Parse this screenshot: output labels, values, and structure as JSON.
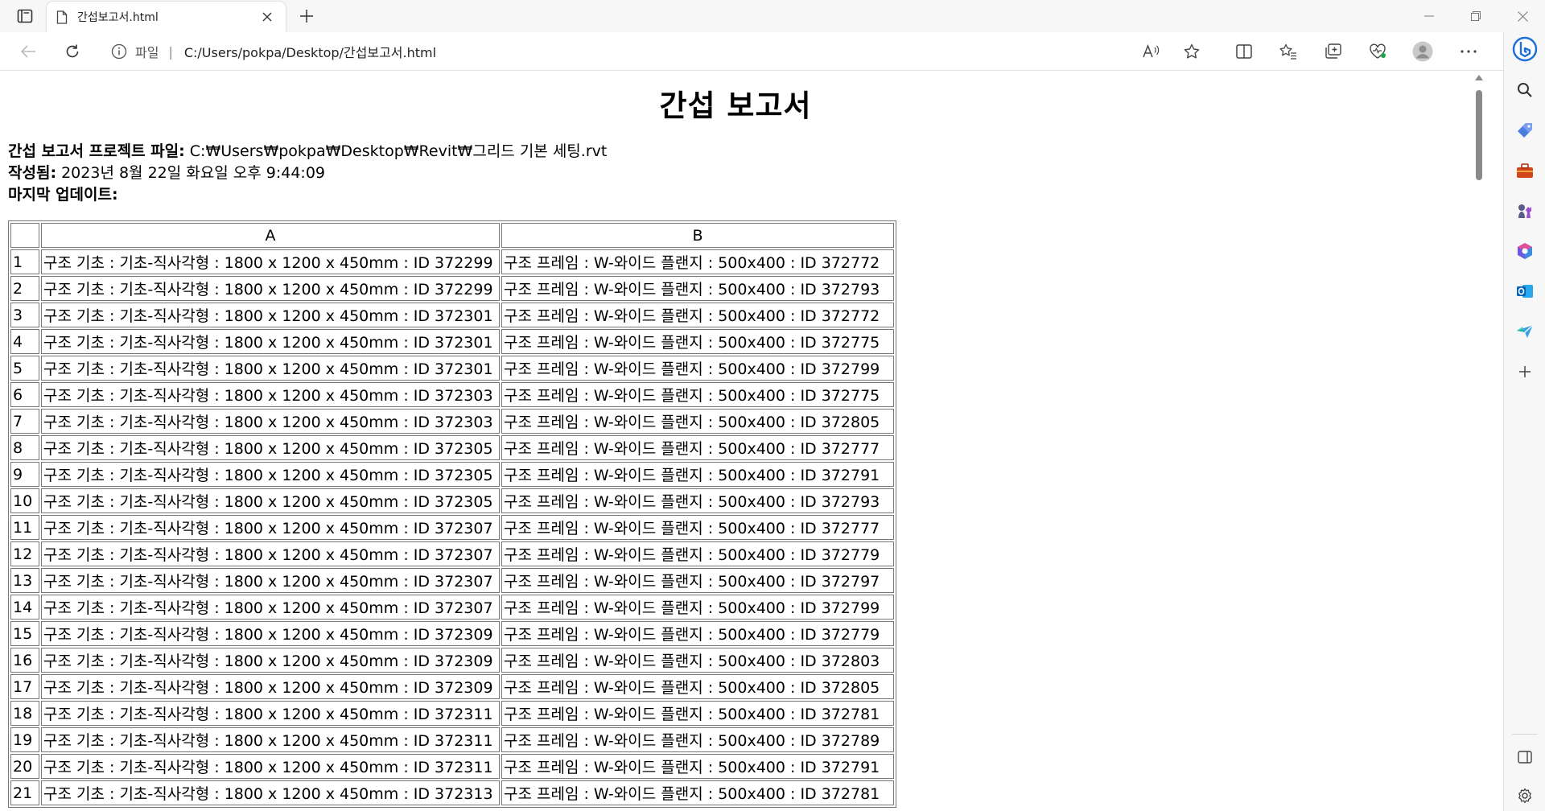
{
  "browser": {
    "tab_title": "간섭보고서.html",
    "address_scheme": "파일",
    "address_path": "C:/Users/pokpa/Desktop/간섭보고서.html"
  },
  "report": {
    "title": "간섭 보고서",
    "project_label": "간섭 보고서 프로젝트 파일:",
    "project_value": "C:₩Users₩pokpa₩Desktop₩Revit₩그리드 기본 세팅.rvt",
    "created_label": "작성됨:",
    "created_value": "2023년 8월 22일 화요일 오후 9:44:09",
    "updated_label": "마지막 업데이트:",
    "table": {
      "headers": [
        "",
        "A",
        "B"
      ],
      "rows": [
        [
          "1",
          "구조 기초 : 기초-직사각형 : 1800 x 1200 x 450mm : ID 372299",
          "구조 프레임 : W-와이드 플랜지 : 500x400 : ID 372772"
        ],
        [
          "2",
          "구조 기초 : 기초-직사각형 : 1800 x 1200 x 450mm : ID 372299",
          "구조 프레임 : W-와이드 플랜지 : 500x400 : ID 372793"
        ],
        [
          "3",
          "구조 기초 : 기초-직사각형 : 1800 x 1200 x 450mm : ID 372301",
          "구조 프레임 : W-와이드 플랜지 : 500x400 : ID 372772"
        ],
        [
          "4",
          "구조 기초 : 기초-직사각형 : 1800 x 1200 x 450mm : ID 372301",
          "구조 프레임 : W-와이드 플랜지 : 500x400 : ID 372775"
        ],
        [
          "5",
          "구조 기초 : 기초-직사각형 : 1800 x 1200 x 450mm : ID 372301",
          "구조 프레임 : W-와이드 플랜지 : 500x400 : ID 372799"
        ],
        [
          "6",
          "구조 기초 : 기초-직사각형 : 1800 x 1200 x 450mm : ID 372303",
          "구조 프레임 : W-와이드 플랜지 : 500x400 : ID 372775"
        ],
        [
          "7",
          "구조 기초 : 기초-직사각형 : 1800 x 1200 x 450mm : ID 372303",
          "구조 프레임 : W-와이드 플랜지 : 500x400 : ID 372805"
        ],
        [
          "8",
          "구조 기초 : 기초-직사각형 : 1800 x 1200 x 450mm : ID 372305",
          "구조 프레임 : W-와이드 플랜지 : 500x400 : ID 372777"
        ],
        [
          "9",
          "구조 기초 : 기초-직사각형 : 1800 x 1200 x 450mm : ID 372305",
          "구조 프레임 : W-와이드 플랜지 : 500x400 : ID 372791"
        ],
        [
          "10",
          "구조 기초 : 기초-직사각형 : 1800 x 1200 x 450mm : ID 372305",
          "구조 프레임 : W-와이드 플랜지 : 500x400 : ID 372793"
        ],
        [
          "11",
          "구조 기초 : 기초-직사각형 : 1800 x 1200 x 450mm : ID 372307",
          "구조 프레임 : W-와이드 플랜지 : 500x400 : ID 372777"
        ],
        [
          "12",
          "구조 기초 : 기초-직사각형 : 1800 x 1200 x 450mm : ID 372307",
          "구조 프레임 : W-와이드 플랜지 : 500x400 : ID 372779"
        ],
        [
          "13",
          "구조 기초 : 기초-직사각형 : 1800 x 1200 x 450mm : ID 372307",
          "구조 프레임 : W-와이드 플랜지 : 500x400 : ID 372797"
        ],
        [
          "14",
          "구조 기초 : 기초-직사각형 : 1800 x 1200 x 450mm : ID 372307",
          "구조 프레임 : W-와이드 플랜지 : 500x400 : ID 372799"
        ],
        [
          "15",
          "구조 기초 : 기초-직사각형 : 1800 x 1200 x 450mm : ID 372309",
          "구조 프레임 : W-와이드 플랜지 : 500x400 : ID 372779"
        ],
        [
          "16",
          "구조 기초 : 기초-직사각형 : 1800 x 1200 x 450mm : ID 372309",
          "구조 프레임 : W-와이드 플랜지 : 500x400 : ID 372803"
        ],
        [
          "17",
          "구조 기초 : 기초-직사각형 : 1800 x 1200 x 450mm : ID 372309",
          "구조 프레임 : W-와이드 플랜지 : 500x400 : ID 372805"
        ],
        [
          "18",
          "구조 기초 : 기초-직사각형 : 1800 x 1200 x 450mm : ID 372311",
          "구조 프레임 : W-와이드 플랜지 : 500x400 : ID 372781"
        ],
        [
          "19",
          "구조 기초 : 기초-직사각형 : 1800 x 1200 x 450mm : ID 372311",
          "구조 프레임 : W-와이드 플랜지 : 500x400 : ID 372789"
        ],
        [
          "20",
          "구조 기초 : 기초-직사각형 : 1800 x 1200 x 450mm : ID 372311",
          "구조 프레임 : W-와이드 플랜지 : 500x400 : ID 372791"
        ],
        [
          "21",
          "구조 기초 : 기초-직사각형 : 1800 x 1200 x 450mm : ID 372313",
          "구조 프레임 : W-와이드 플랜지 : 500x400 : ID 372781"
        ]
      ]
    }
  },
  "icons": {
    "tab_actions": "tab-actions-icon",
    "tab_file": "file-icon",
    "tab_close": "close-icon",
    "new_tab": "plus-icon",
    "minimize": "minimize-icon",
    "restore": "restore-icon",
    "close_window": "close-icon",
    "back": "back-arrow-icon",
    "refresh": "refresh-icon",
    "info": "info-icon",
    "read_aloud": "read-aloud-icon",
    "favorite": "star-icon",
    "split_screen": "split-screen-icon",
    "favorites": "favorites-icon",
    "collections": "collections-icon",
    "browser_essentials": "heart-pulse-icon",
    "profile": "avatar-icon",
    "more": "more-icon",
    "copilot": "copilot-icon",
    "sidebar_search": "search-icon",
    "sidebar_shopping": "tag-icon",
    "sidebar_tools": "toolbox-icon",
    "sidebar_games": "chess-icon",
    "sidebar_office": "office-icon",
    "sidebar_outlook": "outlook-icon",
    "sidebar_drop": "send-icon",
    "sidebar_add": "plus-icon",
    "sidebar_panel": "sidebar-panel-icon",
    "sidebar_settings": "gear-icon"
  }
}
